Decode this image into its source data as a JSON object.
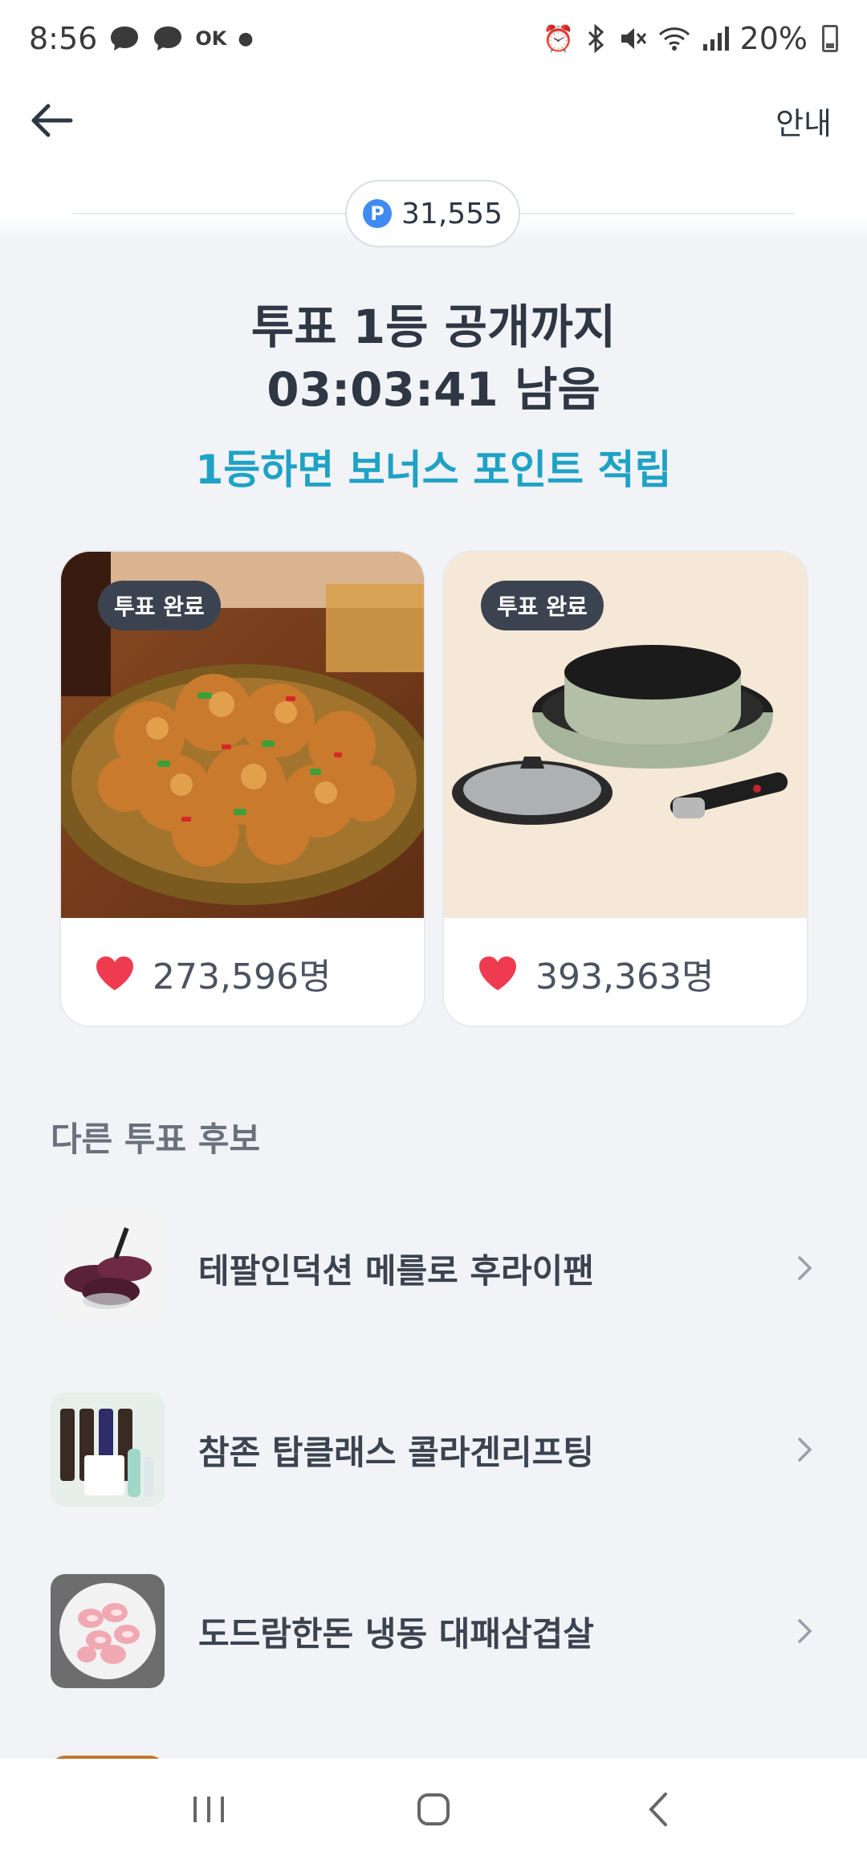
{
  "status_bar": {
    "time": "8:56",
    "ok_label": "OK",
    "battery": "20%"
  },
  "header": {
    "guide_label": "안내"
  },
  "points": {
    "value": "31,555",
    "icon_letter": "P"
  },
  "headline": {
    "line1": "투표 1등 공개까지",
    "line2": "03:03:41 남음"
  },
  "bonus_text": "1등하면 보너스 포인트 적립",
  "vote_cards": [
    {
      "badge": "투표 완료",
      "count": "273,596명"
    },
    {
      "badge": "투표 완료",
      "count": "393,363명"
    }
  ],
  "other_candidates": {
    "title": "다른 투표 후보",
    "items": [
      {
        "label": "테팔인덕션 메를로 후라이팬"
      },
      {
        "label": "참존 탑클래스 콜라겐리프팅"
      },
      {
        "label": "도드람한돈 냉동 대패삼겹살"
      }
    ]
  },
  "colors": {
    "accent_teal": "#1ea2c5",
    "heart": "#ee3b4f",
    "point_blue": "#3f8bf2",
    "background": "#f1f3f6"
  }
}
